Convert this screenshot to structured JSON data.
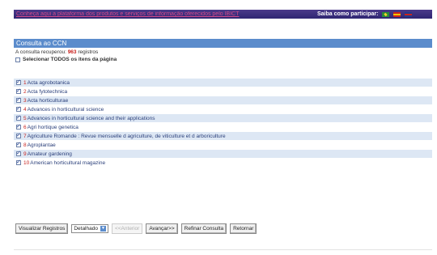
{
  "topbar": {
    "banner_text": "Conheça aqui a plataforma dos produtos e serviços de informação oferecidos pelo IBICT",
    "join_label": "Saiba como participar:",
    "flags": [
      "flag-br",
      "flag-es",
      "flag-uk"
    ]
  },
  "panel": {
    "title": "Consulta ao CCN"
  },
  "summary": {
    "prefix": "A consulta recuperou:",
    "count": "963",
    "suffix": "registros"
  },
  "select_all": {
    "label": "Selecionar TODOS os itens da página"
  },
  "results": [
    {
      "num": "1",
      "title": "Acta agrobotanica"
    },
    {
      "num": "2",
      "title": "Acta fytotechnica"
    },
    {
      "num": "3",
      "title": "Acta horticulturae"
    },
    {
      "num": "4",
      "title": "Advances in horticultural science"
    },
    {
      "num": "5",
      "title": "Advances in horticultural science and their applications"
    },
    {
      "num": "6",
      "title": "Agri hortique genetica"
    },
    {
      "num": "7",
      "title": "Agriculture Romande : Revue mensuelle d agriculture, de viticulture et d arboriculture"
    },
    {
      "num": "8",
      "title": "Agroplantae"
    },
    {
      "num": "9",
      "title": "Amateur gardening"
    },
    {
      "num": "10",
      "title": "American horticultural magazine"
    }
  ],
  "controls": {
    "view_button": "Visualizar Registros",
    "format_select": "Detalhado",
    "prev_button": "<<Anterior",
    "next_button": "Avançar>>",
    "refine_button": "Refinar Consulta",
    "back_button": "Retornar"
  },
  "colors": {
    "header_bg": "#5b8ccc",
    "topbar_bg": "#2f2672",
    "row_alt_bg": "#dde7f4",
    "count_color": "#c8221e"
  }
}
